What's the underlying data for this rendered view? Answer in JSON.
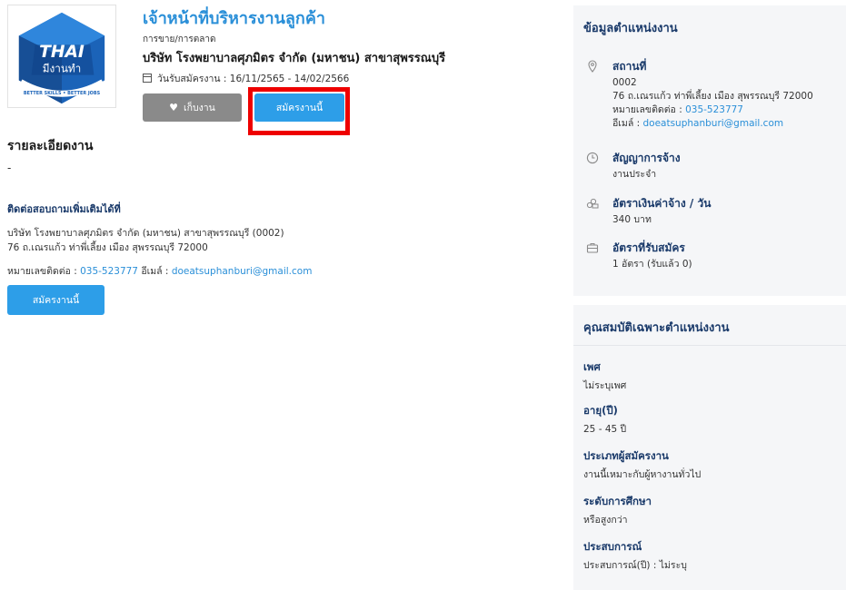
{
  "logo": {
    "brand": "THAI",
    "tagline": "มีงานทำ",
    "ring_text": "BETTER SKILLS • BETTER JOBS"
  },
  "job": {
    "title": "เจ้าหน้าที่บริหารงานลูกค้า",
    "category": "การขาย/การตลาด",
    "company": "บริษัท โรงพยาบาลศุภมิตร จำกัด (มหาชน) สาขาสุพรรณบุรี",
    "dates": "วันรับสมัครงาน : 16/11/2565 - 14/02/2566",
    "save_label": "เก็บงาน",
    "apply_label": "สมัครงานนี้"
  },
  "detail": {
    "heading": "รายละเอียดงาน",
    "value": "-"
  },
  "contact": {
    "heading": "ติดต่อสอบถามเพิ่มเติมได้ที่",
    "line1": "บริษัท โรงพยาบาลศุภมิตร จำกัด (มหาชน) สาขาสุพรรณบุรี (0002)",
    "line2": "76 ถ.เณรแก้ว ท่าพี่เลี้ยง เมือง สุพรรณบุรี 72000",
    "phone_label": "หมายเลขติดต่อ :",
    "phone": "035-523777",
    "email_label": "อีเมล์ :",
    "email": "doeatsuphanburi@gmail.com",
    "apply_label": "สมัครงานนี้"
  },
  "position_info": {
    "title": "ข้อมูลตำแหน่งงาน",
    "location": {
      "icon": "location-pin-icon",
      "label": "สถานที่",
      "code": "0002",
      "address": "76 ถ.เณรแก้ว ท่าพี่เลี้ยง เมือง สุพรรณบุรี 72000",
      "phone_label": "หมายเลขติดต่อ :",
      "phone": "035-523777",
      "email_label": "อีเมล์ :",
      "email": "doeatsuphanburi@gmail.com"
    },
    "contract": {
      "icon": "clock-icon",
      "label": "สัญญาการจ้าง",
      "value": "งานประจำ"
    },
    "wage": {
      "icon": "money-icon",
      "label": "อัตราเงินค่าจ้าง / วัน",
      "value": "340 บาท"
    },
    "openings": {
      "icon": "briefcase-icon",
      "label": "อัตราที่รับสมัคร",
      "value": "1 อัตรา (รับแล้ว 0)"
    }
  },
  "qualifications": {
    "title": "คุณสมบัติเฉพาะตำแหน่งงาน",
    "items": [
      {
        "label": "เพศ",
        "value": "ไม่ระบุเพศ"
      },
      {
        "label": "อายุ(ปี)",
        "value": "25 - 45 ปี"
      },
      {
        "label": "ประเภทผู้สมัครงาน",
        "value": "งานนี้เหมาะกับผู้หางานทั่วไป"
      },
      {
        "label": "ระดับการศึกษา",
        "value": "หรือสูงกว่า"
      },
      {
        "label": "ประสบการณ์",
        "value": "ประสบการณ์(ปี) : ไม่ระบุ"
      }
    ]
  }
}
